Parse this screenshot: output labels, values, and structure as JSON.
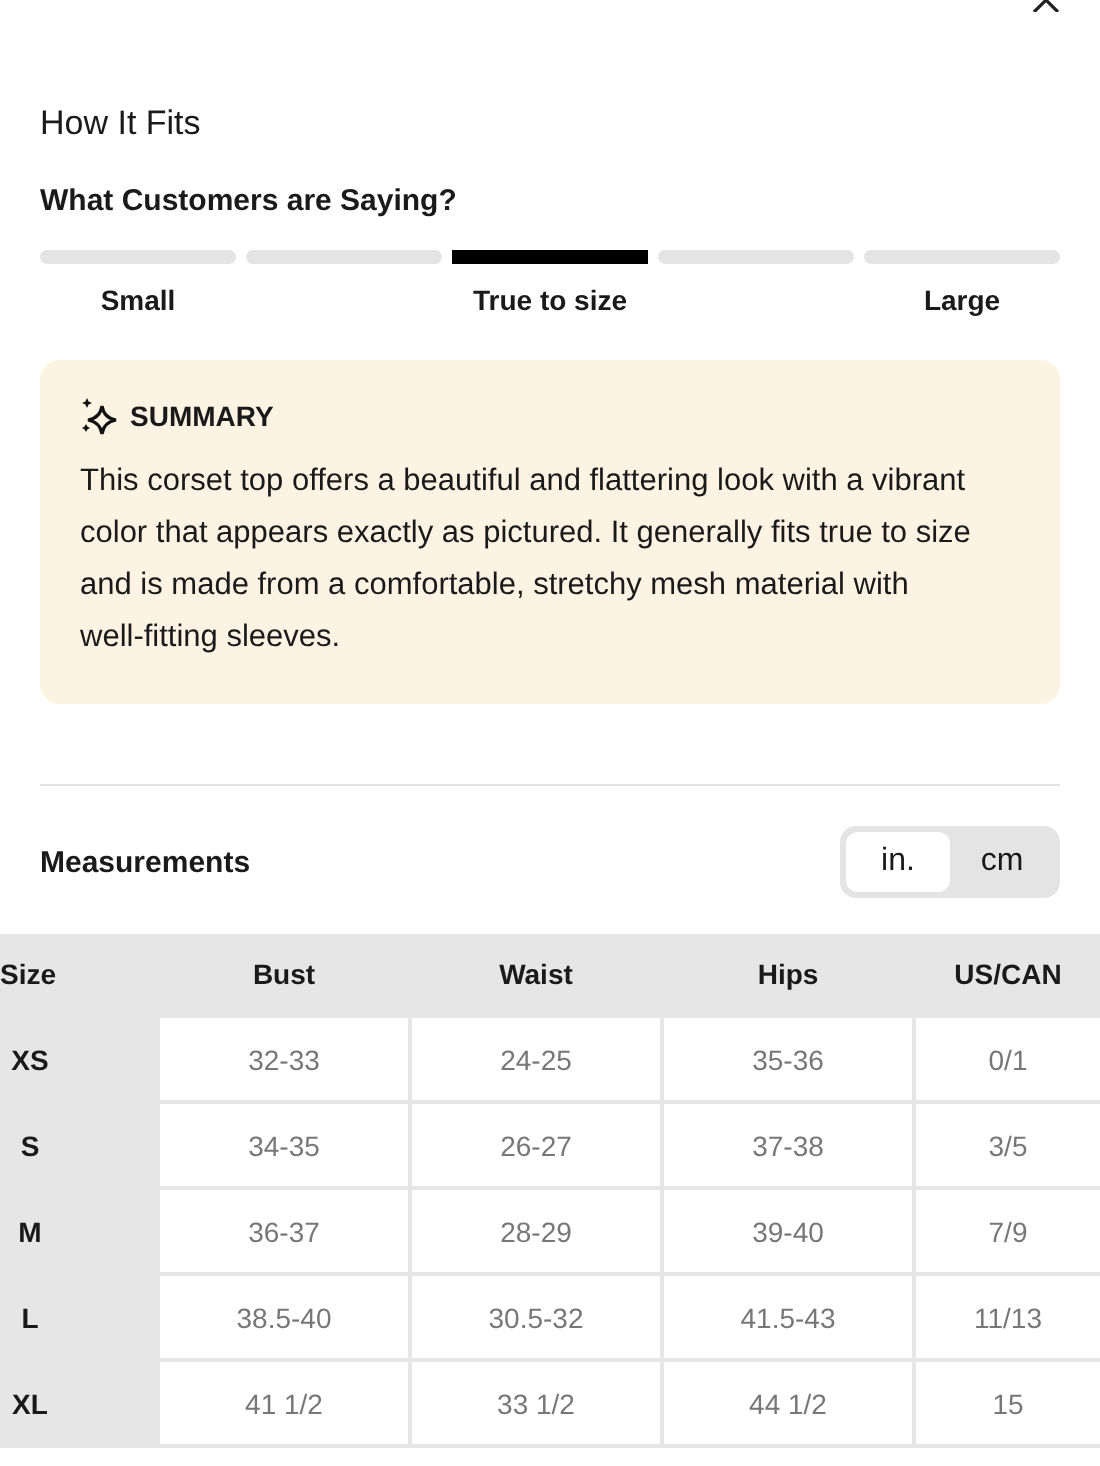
{
  "fit": {
    "heading": "How It Fits",
    "question": "What Customers are Saying?",
    "segments": [
      {
        "selected": false,
        "label": "Small"
      },
      {
        "selected": false
      },
      {
        "selected": true,
        "label": "True to size"
      },
      {
        "selected": false
      },
      {
        "selected": false,
        "label": "Large"
      }
    ]
  },
  "summary": {
    "title": "SUMMARY",
    "text": "This corset top offers a beautiful and flattering look with a vibrant color that appears exactly as pictured. It generally fits true to size and is made from a comfortable, stretchy mesh material with well-fitting sleeves."
  },
  "measurements": {
    "title": "Measurements",
    "units": [
      {
        "label": "in.",
        "selected": true
      },
      {
        "label": "cm",
        "selected": false
      }
    ]
  },
  "table": {
    "columns": [
      "Size",
      "Bust",
      "Waist",
      "Hips",
      "US/CAN"
    ],
    "rows": [
      [
        "XS",
        "32-33",
        "24-25",
        "35-36",
        "0/1"
      ],
      [
        "S",
        "34-35",
        "26-27",
        "37-38",
        "3/5"
      ],
      [
        "M",
        "36-37",
        "28-29",
        "39-40",
        "7/9"
      ],
      [
        "L",
        "38.5-40",
        "30.5-32",
        "41.5-43",
        "11/13"
      ],
      [
        "XL",
        "41 1/2",
        "33 1/2",
        "44 1/2",
        "15"
      ]
    ]
  }
}
